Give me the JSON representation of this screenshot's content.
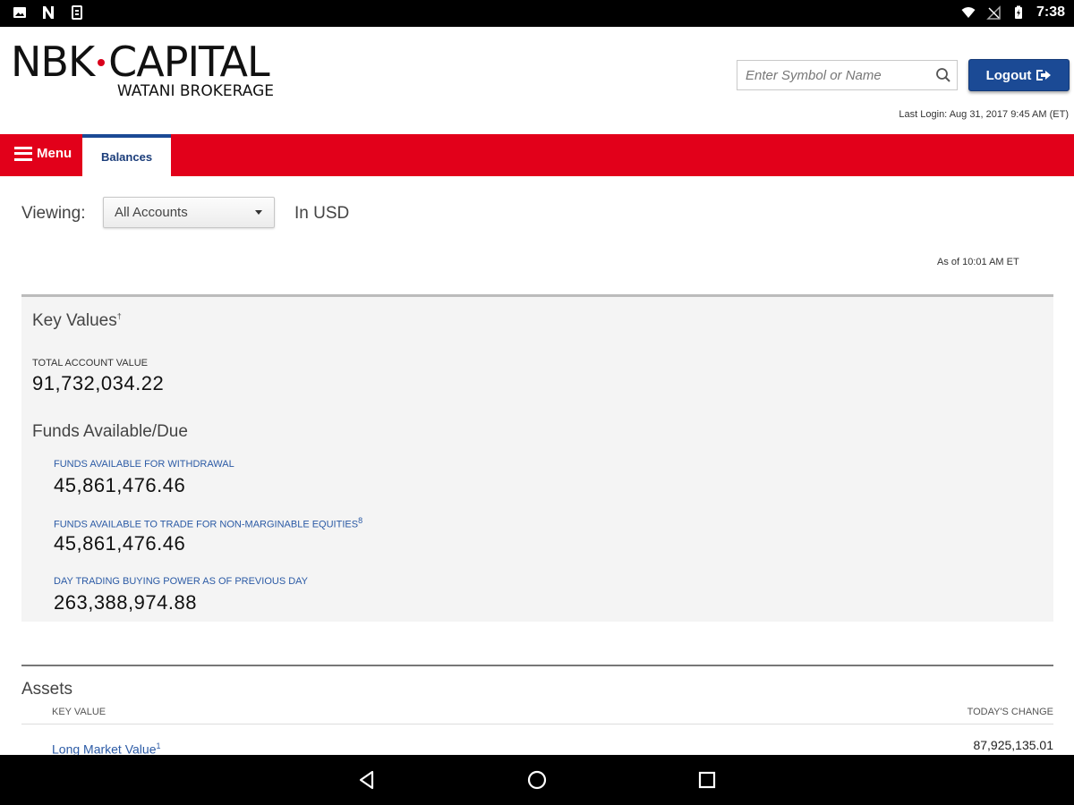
{
  "status_bar": {
    "time": "7:38",
    "left_icons": [
      "image-icon",
      "n-icon",
      "clipboard-icon"
    ],
    "right_icons": [
      "wifi-icon",
      "signal-off-icon",
      "battery-charging-icon"
    ]
  },
  "header": {
    "logo_left": "NBK",
    "logo_right": "CAPITAL",
    "logo_sub": "WATANI BROKERAGE",
    "search_placeholder": "Enter Symbol or Name",
    "logout_label": "Logout",
    "last_login": "Last Login: Aug 31, 2017 9:45 AM (ET)"
  },
  "nav": {
    "menu_label": "Menu",
    "active_tab": "Balances"
  },
  "viewing": {
    "label": "Viewing:",
    "selected_account": "All Accounts",
    "currency": "In USD",
    "as_of": "As of 10:01 AM ET"
  },
  "key_values": {
    "title": "Key Values",
    "title_mark": "†",
    "total_account_value_label": "TOTAL ACCOUNT VALUE",
    "total_account_value": "91,732,034.22",
    "funds_title": "Funds Available/Due",
    "funds": [
      {
        "label": "FUNDS AVAILABLE FOR WITHDRAWAL",
        "mark": "",
        "value": "45,861,476.46"
      },
      {
        "label": "FUNDS AVAILABLE TO TRADE FOR NON-MARGINABLE EQUITIES",
        "mark": "8",
        "value": "45,861,476.46"
      },
      {
        "label": "DAY TRADING BUYING POWER AS OF PREVIOUS DAY",
        "mark": "",
        "value": "263,388,974.88"
      }
    ]
  },
  "assets": {
    "title": "Assets",
    "col_key": "KEY VALUE",
    "col_change": "TODAY'S CHANGE",
    "rows": [
      {
        "label": "Long Market Value",
        "mark": "1",
        "value": "87,925,135.01"
      }
    ]
  },
  "colors": {
    "brand_red": "#e2001a",
    "brand_blue": "#1b4a95",
    "link_blue": "#2b5aa5"
  }
}
